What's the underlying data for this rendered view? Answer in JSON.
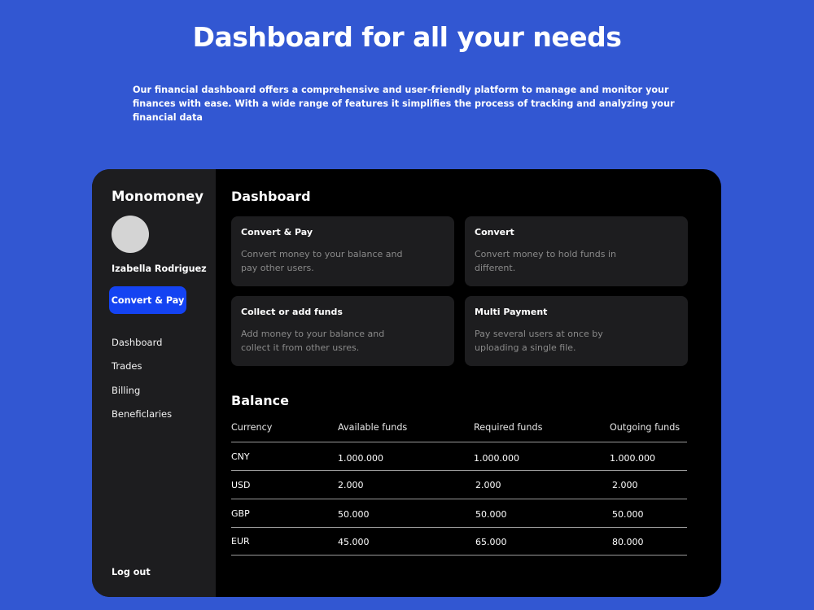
{
  "hero": {
    "title": "Dashboard for all your needs",
    "description": "Our financial dashboard offers a comprehensive and user-friendly platform to manage and monitor your finances with ease.  With a wide range of features it simplifies the process of tracking and analyzing your financial data"
  },
  "sidebar": {
    "brand": "Monomoney",
    "user_name": "Izabella Rodriguez",
    "cta_label": "Convert & Pay",
    "nav": [
      {
        "label": "Dashboard"
      },
      {
        "label": "Trades"
      },
      {
        "label": "Billing"
      },
      {
        "label": "Beneficlaries"
      }
    ],
    "logout_label": "Log out"
  },
  "dashboard": {
    "title": "Dashboard",
    "cards": [
      {
        "title": "Convert & Pay",
        "description": "Convert money to your balance and  pay other users."
      },
      {
        "title": "Convert",
        "description": "Convert money to hold funds in different."
      },
      {
        "title": "Collect or add funds",
        "description": "Add money to your balance and collect it from other usres."
      },
      {
        "title": "Multi Payment",
        "description": "Pay several users at once by uploading a single file."
      }
    ]
  },
  "balance": {
    "title": "Balance",
    "headers": [
      "Currency",
      "Available funds",
      "Required  funds",
      "Outgoing  funds"
    ],
    "rows": [
      {
        "currency": "CNY",
        "available": "1.000.000",
        "required": "1.000.000",
        "outgoing": "1.000.000"
      },
      {
        "currency": "USD",
        "available": "2.000",
        "required": "2.000",
        "outgoing": "2.000"
      },
      {
        "currency": "GBP",
        "available": "50.000",
        "required": "50.000",
        "outgoing": "50.000"
      },
      {
        "currency": "EUR",
        "available": "45.000",
        "required": "65.000",
        "outgoing": "80.000"
      }
    ]
  },
  "colors": {
    "page_background": "#3257d2",
    "app_background": "#000000",
    "sidebar_background": "#1d1d1f",
    "accent_button": "#1443f2",
    "card_background": "#1d1d1f",
    "muted_text": "#8a8a8a"
  }
}
